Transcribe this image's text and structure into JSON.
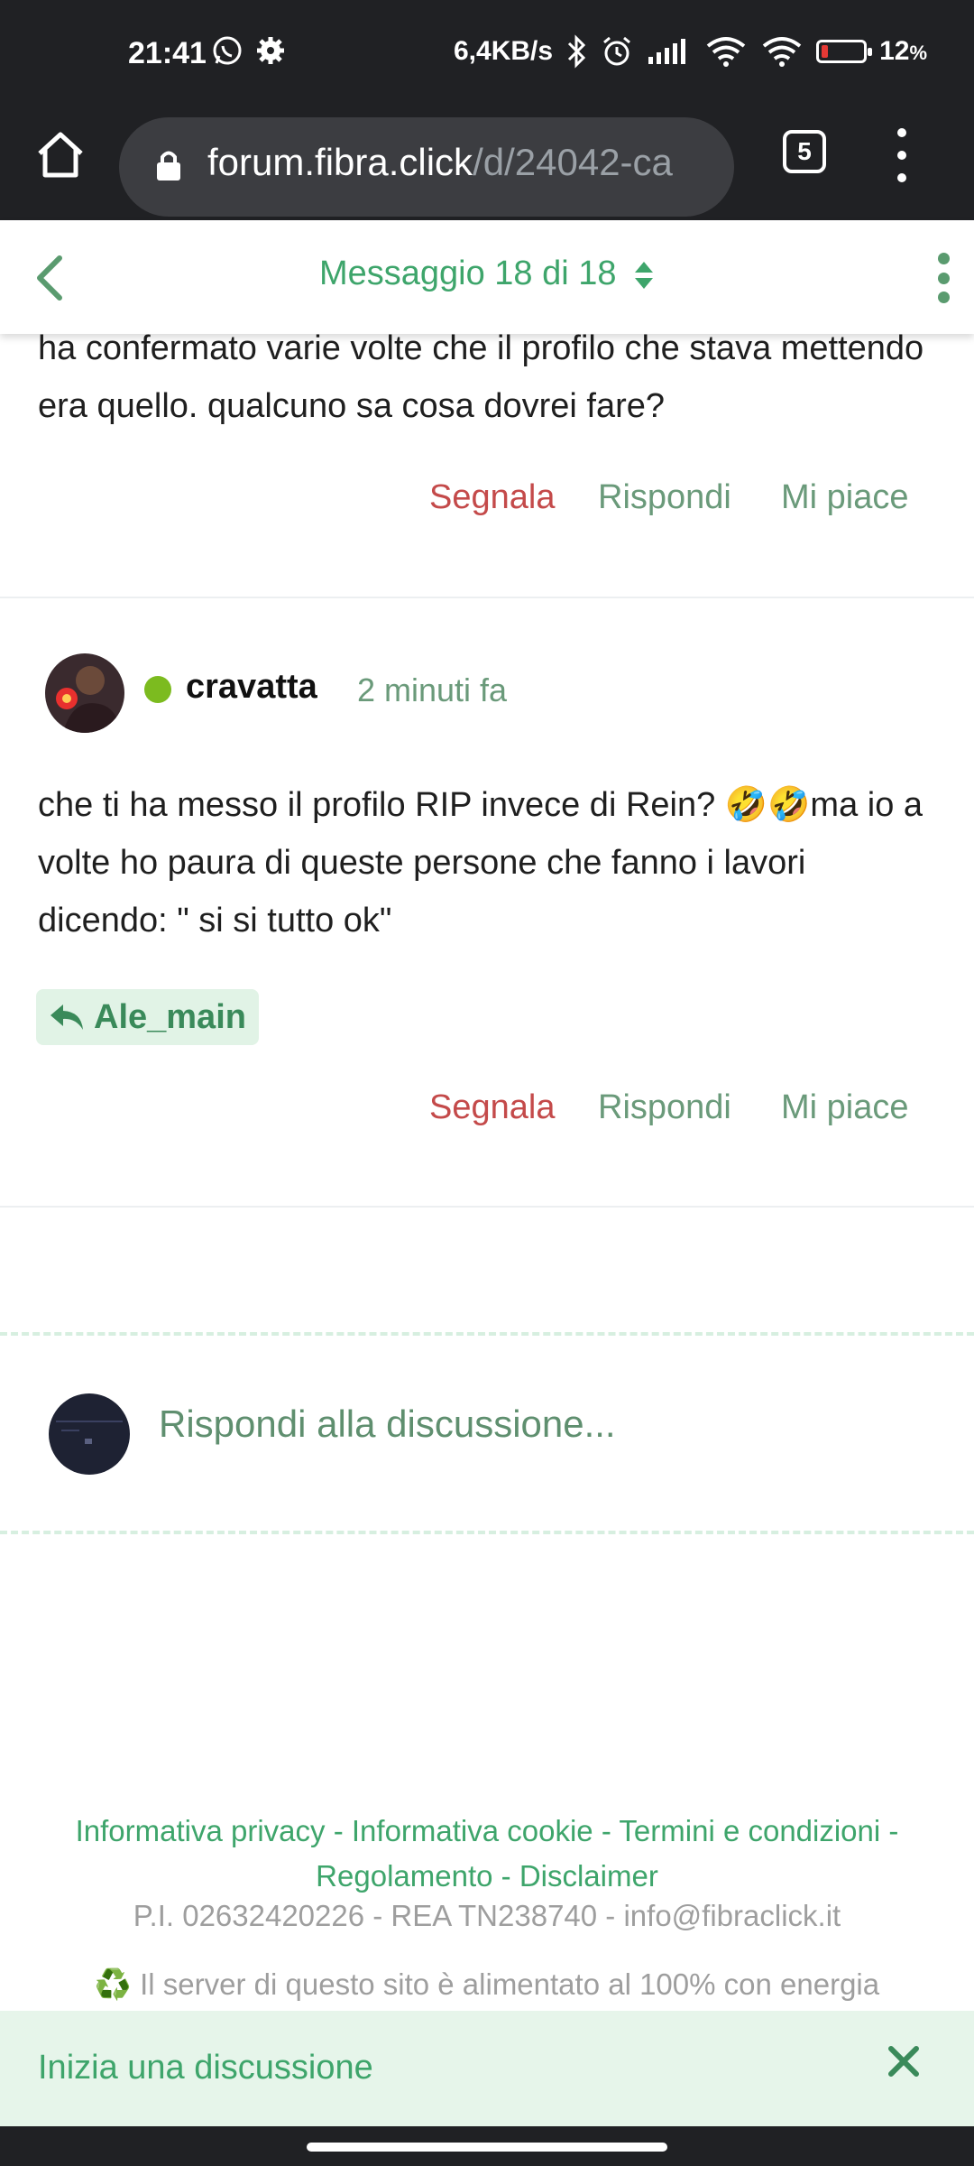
{
  "status_bar": {
    "time": "21:41",
    "network_speed": "6,4KB/s",
    "battery_percent": "12",
    "battery_unit": "%",
    "battery_color": "#e53935"
  },
  "browser": {
    "url_host": "forum.fibra.click",
    "url_path": "/d/24042-ca",
    "tab_count": "5"
  },
  "forum_header": {
    "title": "Messaggio 18 di 18"
  },
  "previous_post": {
    "text": "ha confermato varie volte che il profilo che stava mettendo era quello. qualcuno sa cosa dovrei fare?",
    "actions": {
      "report": "Segnala",
      "reply": "Rispondi",
      "like": "Mi piace"
    }
  },
  "post": {
    "username": "cravatta",
    "time_ago": "2 minuti fa",
    "text": "che ti ha messo il profilo RIP invece di Rein? 🤣🤣ma io a volte ho paura di queste persone che fanno i lavori dicendo: \" si si tutto ok\"",
    "mention": "Ale_main",
    "actions": {
      "report": "Segnala",
      "reply": "Rispondi",
      "like": "Mi piace"
    }
  },
  "composer": {
    "placeholder": "Rispondi alla discussione..."
  },
  "footer": {
    "link_privacy": "Informativa privacy",
    "link_cookie": "Informativa cookie",
    "link_terms": "Termini e condizioni",
    "link_rules": "Regolamento",
    "link_disclaimer": "Disclaimer",
    "separator": "-",
    "company_info": "P.I. 02632420226 - REA TN238740 - info@fibraclick.it",
    "green_energy": "♻️ Il server di questo sito è alimentato al 100% con energia"
  },
  "start_discussion": {
    "label": "Inizia una discussione"
  },
  "colors": {
    "accent_green": "#3ea56b",
    "report_red": "#c44a4a",
    "online_dot": "#7cbb1f"
  },
  "icons": [
    "whatsapp-icon",
    "gear-icon",
    "bluetooth-icon",
    "alarm-icon",
    "signal-icon",
    "wifi-icon",
    "home-icon",
    "lock-icon",
    "back-chevron-icon",
    "sort-icon",
    "kebab-menu-icon",
    "reply-icon",
    "close-icon"
  ]
}
